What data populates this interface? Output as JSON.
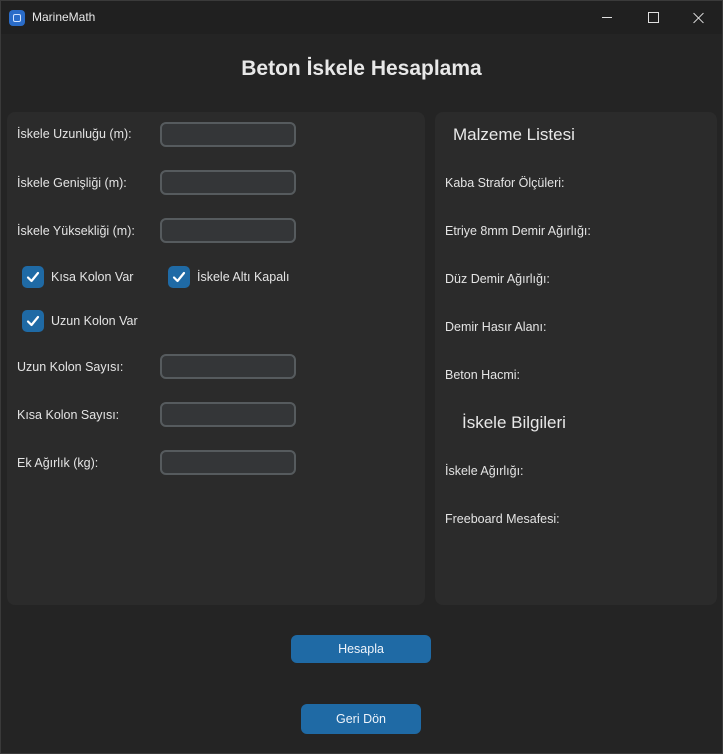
{
  "window": {
    "title": "MarineMath",
    "icon": "app-icon",
    "controls": [
      "minimize-icon",
      "maximize-icon",
      "close-icon"
    ]
  },
  "heading": "Beton İskele Hesaplama",
  "form": {
    "length_label": "İskele Uzunluğu (m):",
    "length_value": "",
    "width_label": "İskele Genişliği (m):",
    "width_value": "",
    "height_label": "İskele Yüksekliği (m):",
    "height_value": "",
    "short_column_label": "Kısa Kolon Var",
    "short_column_checked": true,
    "closed_bottom_label": "İskele Altı Kapalı",
    "closed_bottom_checked": true,
    "long_column_label": "Uzun Kolon Var",
    "long_column_checked": true,
    "long_count_label": "Uzun Kolon Sayısı:",
    "long_count_value": "",
    "short_count_label": "Kısa Kolon Sayısı:",
    "short_count_value": "",
    "extra_weight_label": "Ek Ağırlık (kg):",
    "extra_weight_value": ""
  },
  "materials": {
    "title": "Malzeme Listesi",
    "items": [
      "Kaba Strafor Ölçüleri:",
      "Etriye 8mm Demir Ağırlığı:",
      "Düz Demir Ağırlığı:",
      "Demir Hasır Alanı:",
      "Beton Hacmi:"
    ]
  },
  "pier_info": {
    "title": "İskele Bilgileri",
    "items": [
      "İskele Ağırlığı:",
      "Freeboard Mesafesi:"
    ]
  },
  "buttons": {
    "calculate": "Hesapla",
    "back": "Geri Dön"
  },
  "colors": {
    "accent": "#1f6aa5",
    "panel": "#2b2b2b",
    "background": "#242424"
  }
}
